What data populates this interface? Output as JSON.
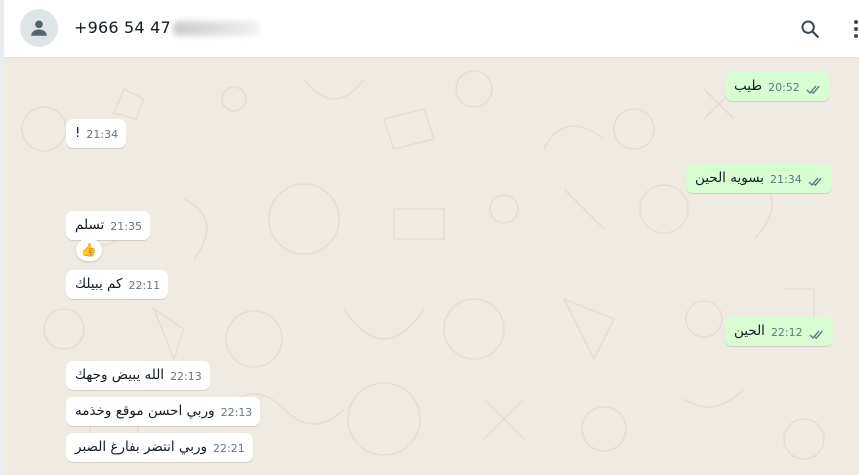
{
  "header": {
    "contact_name": "+966 54 47",
    "avatar_icon": "person-icon",
    "search_icon": "search-icon",
    "menu_icon": "more-vertical-icon"
  },
  "colors": {
    "chat_background": "#efeae2",
    "incoming_bubble": "#ffffff",
    "outgoing_bubble": "#d9fdd3",
    "read_ticks": "#667781"
  },
  "messages": [
    {
      "direction": "out",
      "text": "طيب",
      "time": "20:52",
      "ticks": "double-check-icon"
    },
    {
      "direction": "in",
      "text": "!",
      "time": "21:34"
    },
    {
      "direction": "out",
      "text": "بسويه الحين",
      "time": "21:34",
      "ticks": "double-check-icon"
    },
    {
      "direction": "in",
      "text": "تسلم",
      "time": "21:35",
      "reaction": "👍"
    },
    {
      "direction": "in",
      "text": "كم يبيلك",
      "time": "22:11"
    },
    {
      "direction": "out",
      "text": "الحين",
      "time": "22:12",
      "ticks": "double-check-icon"
    },
    {
      "direction": "in",
      "text": "الله يبيض وجهك",
      "time": "22:13"
    },
    {
      "direction": "in",
      "text": "وربي احسن موقع وخذمه",
      "time": "22:13"
    },
    {
      "direction": "in",
      "text": "وربي انتضر بفارغ الصبر",
      "time": "22:21"
    }
  ]
}
